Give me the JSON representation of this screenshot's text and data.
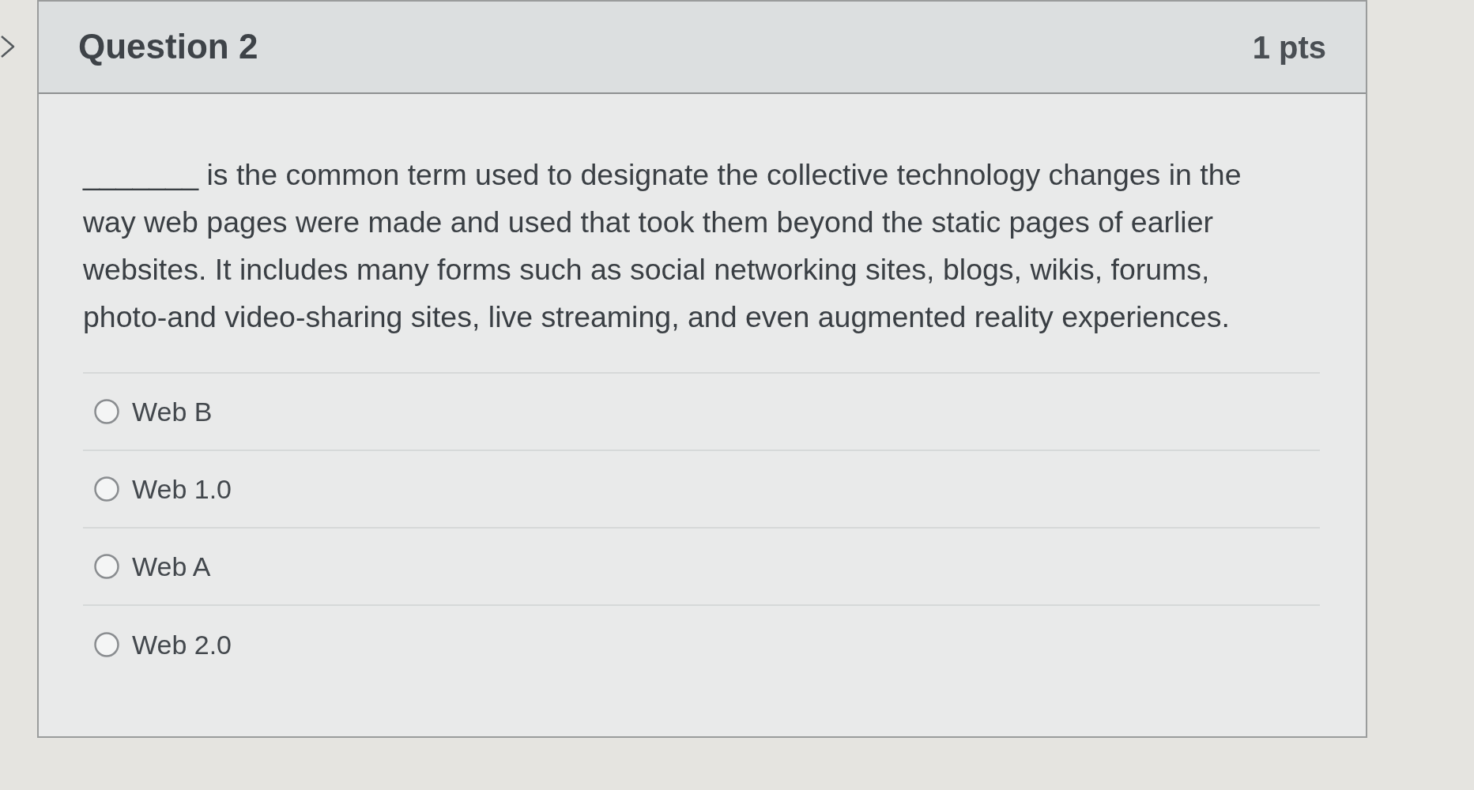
{
  "question": {
    "title": "Question 2",
    "points": "1 pts",
    "text": "_______ is the common term used to designate the collective technology changes in the way web pages were made and used that took them beyond the static pages of earlier websites. It includes many forms such as social networking sites, blogs, wikis, forums, photo-and video-sharing sites, live streaming, and even augmented reality experiences.",
    "answers": [
      {
        "label": "Web B",
        "selected": false
      },
      {
        "label": "Web 1.0",
        "selected": false
      },
      {
        "label": "Web A",
        "selected": false
      },
      {
        "label": "Web 2.0",
        "selected": false
      }
    ]
  }
}
